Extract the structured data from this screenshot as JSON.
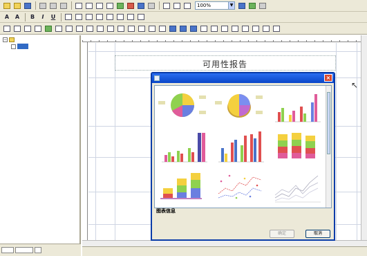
{
  "toolbar": {
    "zoom_value": "100%",
    "align_left_label": "A",
    "align_right_label": "A",
    "bold_label": "B",
    "italic_label": "I",
    "underline_label": "U"
  },
  "document": {
    "title": "可用性报告"
  },
  "tree": {
    "root_expander": "−"
  },
  "dialog": {
    "close_glyph": "×",
    "description_label": "图表信息",
    "ok_label": "确定",
    "cancel_label": "取消"
  },
  "colors": {
    "accent_blue": "#0a46c8",
    "selection_blue": "#316ac5",
    "window_bg": "#ece9d8",
    "close_red": "#d8472c"
  }
}
